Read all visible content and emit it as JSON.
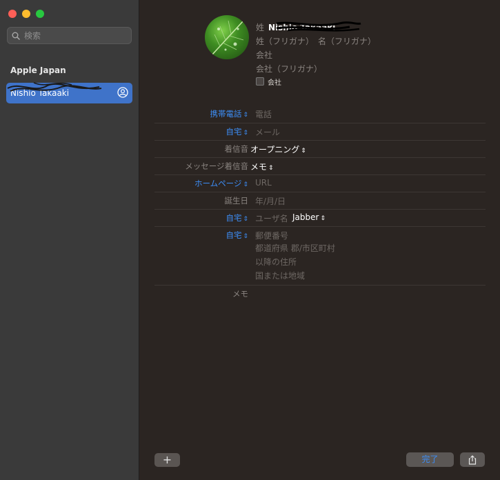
{
  "window": {
    "controls": [
      "close",
      "minimize",
      "zoom"
    ]
  },
  "sidebar": {
    "search": {
      "placeholder": "検索",
      "icon": "search-icon"
    },
    "group_title": "Apple Japan",
    "contacts": [
      {
        "name": "Nishio Takaaki",
        "selected": true,
        "icon": "person-circle-icon"
      }
    ]
  },
  "card": {
    "last_name_label": "姓",
    "first_name_value": "Nishio Takaaki",
    "furigana_last": "姓（フリガナ）",
    "furigana_first": "名（フリガナ）",
    "company": "会社",
    "company_furigana": "会社（フリガナ）",
    "company_checkbox": "会社",
    "fields": [
      {
        "label": "携帯電話",
        "value": "電話"
      },
      {
        "label": "自宅",
        "value": "メール"
      },
      {
        "label": "着信音",
        "value": "オープニング"
      },
      {
        "label": "メッセージ着信音",
        "value": "メモ"
      },
      {
        "label": "ホームページ",
        "value": "URL"
      },
      {
        "label": "誕生日",
        "value": "年/月/日"
      },
      {
        "label": "自宅",
        "value": "ユーザ名",
        "value2": "Jabber"
      },
      {
        "label": "自宅",
        "value": "郵便番号"
      }
    ],
    "address_lines": [
      "都道府県 郡/市区町村",
      "以降の住所",
      "国または地域"
    ],
    "memo_label": "メモ"
  },
  "footer": {
    "add_label": "+",
    "done_label": "完了",
    "share_icon": "share-icon"
  },
  "colors": {
    "accent": "#3d8ef7",
    "selection": "#3f73c9",
    "background": "#2b2522",
    "sidebar": "#3a3a3a"
  }
}
